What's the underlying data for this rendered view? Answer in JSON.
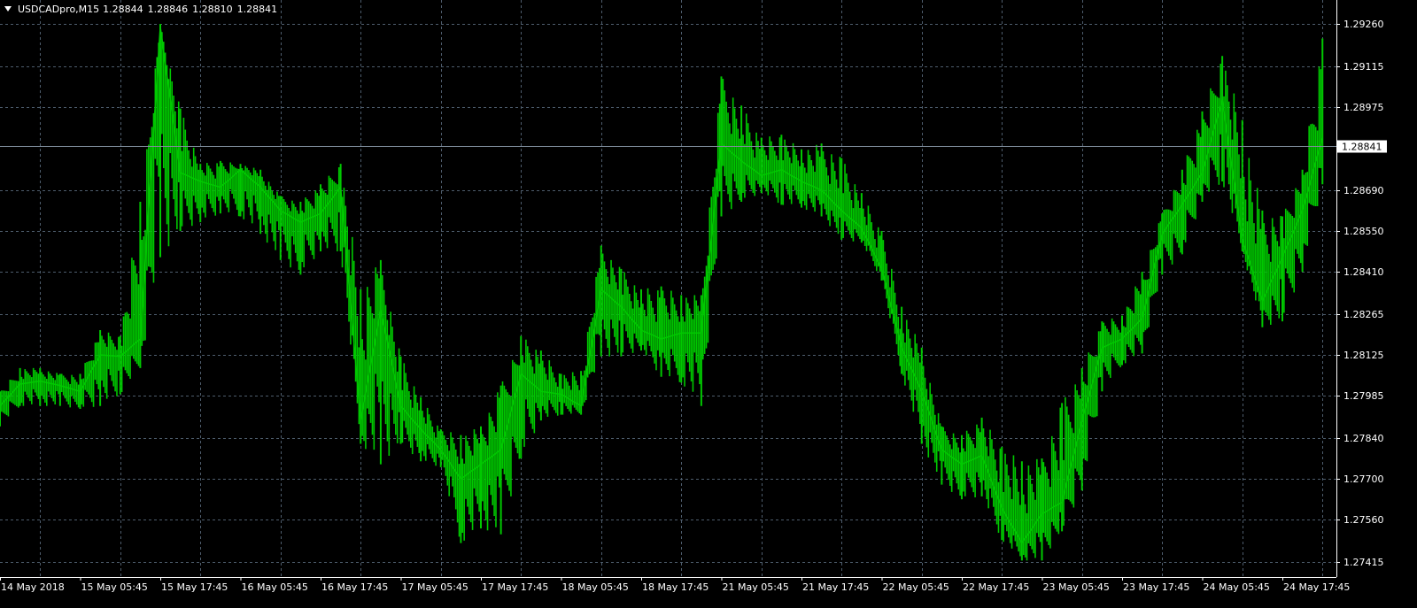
{
  "header": {
    "symbol_timeframe": "USDCADpro,M15",
    "open": "1.28844",
    "high": "1.28846",
    "low": "1.28810",
    "close": "1.28841"
  },
  "colors": {
    "background": "#000000",
    "candles": "#00c800",
    "grid": "#4e5d6d",
    "axis_text": "#ffffff",
    "price_line": "#7d8b99",
    "price_label_bg": "#ffffff",
    "price_label_text": "#000000"
  },
  "chart_data": {
    "type": "line",
    "style": "bar-candlestick",
    "symbol": "USDCADpro",
    "timeframe": "M15",
    "grid": true,
    "ylim": [
      1.2735,
      1.2935
    ],
    "y_ticks": [
      "1.29260",
      "1.29115",
      "1.28975",
      "1.28690",
      "1.28550",
      "1.28410",
      "1.28265",
      "1.28125",
      "1.27985",
      "1.27840",
      "1.27700",
      "1.27560",
      "1.27415"
    ],
    "y_tick_values": [
      1.2926,
      1.29115,
      1.28975,
      1.2869,
      1.2855,
      1.2841,
      1.28265,
      1.28125,
      1.27985,
      1.2784,
      1.277,
      1.2756,
      1.27415
    ],
    "current_price": "1.28841",
    "current_price_value": 1.28841,
    "x_labels": [
      "14 May 2018",
      "15 May 05:45",
      "15 May 17:45",
      "16 May 05:45",
      "16 May 17:45",
      "17 May 05:45",
      "17 May 17:45",
      "18 May 05:45",
      "18 May 17:45",
      "21 May 05:45",
      "21 May 17:45",
      "22 May 05:45",
      "22 May 17:45",
      "23 May 05:45",
      "23 May 17:45",
      "24 May 05:45",
      "24 May 17:45"
    ],
    "series": [
      {
        "x": [
          0,
          0.25,
          0.5,
          0.75,
          1,
          1.25,
          1.5,
          1.75,
          2,
          2.25,
          2.5,
          2.75,
          3,
          3.25,
          3.5,
          3.75,
          4,
          4.25,
          4.5,
          4.75,
          5,
          5.25,
          5.5,
          5.75,
          6,
          6.25,
          6.5,
          6.75,
          7,
          7.25,
          7.5,
          7.75,
          8,
          8.25,
          8.5,
          8.75,
          9,
          9.25,
          9.5,
          9.75,
          10,
          10.25,
          10.5,
          10.75,
          11,
          11.25,
          11.5,
          11.75,
          12,
          12.25,
          12.5,
          12.75,
          13,
          13.25,
          13.5,
          13.75,
          14,
          14.25,
          14.5,
          14.75,
          15,
          15.25,
          15.5,
          15.75,
          16,
          16.25,
          16.5
        ],
        "values": [
          1.2795,
          1.28025,
          1.28035,
          1.2802,
          1.28,
          1.28125,
          1.2812,
          1.2818,
          1.2925,
          1.2875,
          1.2872,
          1.287,
          1.2876,
          1.287,
          1.2862,
          1.2858,
          1.2861,
          1.287,
          1.279,
          1.2828,
          1.2795,
          1.2787,
          1.278,
          1.277,
          1.2775,
          1.278,
          1.2806,
          1.28,
          1.2799,
          1.2795,
          1.2835,
          1.2829,
          1.2821,
          1.2818,
          1.282,
          1.282,
          1.2885,
          1.2879,
          1.2874,
          1.2876,
          1.2872,
          1.2869,
          1.2862,
          1.2856,
          1.2842,
          1.2815,
          1.28,
          1.278,
          1.2775,
          1.2778,
          1.276,
          1.2748,
          1.2758,
          1.2762,
          1.279,
          1.2815,
          1.2818,
          1.2825,
          1.2854,
          1.2864,
          1.2875,
          1.29,
          1.2852,
          1.2831,
          1.2846,
          1.2862,
          1.2887
        ],
        "high": [
          1.28,
          1.2808,
          1.2808,
          1.2806,
          1.2806,
          1.2821,
          1.2819,
          1.2865,
          1.2926,
          1.2897,
          1.2878,
          1.2879,
          1.2878,
          1.2876,
          1.2867,
          1.2865,
          1.2871,
          1.2878,
          1.2835,
          1.2845,
          1.2812,
          1.2798,
          1.2787,
          1.2785,
          1.2788,
          1.2802,
          1.2819,
          1.2814,
          1.2806,
          1.2807,
          1.285,
          1.2842,
          1.2835,
          1.2836,
          1.2833,
          1.2833,
          1.2908,
          1.2898,
          1.2887,
          1.2888,
          1.2883,
          1.2885,
          1.288,
          1.2868,
          1.2855,
          1.2829,
          1.2815,
          1.2788,
          1.2785,
          1.2791,
          1.2781,
          1.2776,
          1.2777,
          1.2796,
          1.2808,
          1.2824,
          1.2826,
          1.2841,
          1.2861,
          1.2876,
          1.2896,
          1.2915,
          1.2893,
          1.2862,
          1.286,
          1.2876,
          1.2921
        ],
        "low": [
          1.2788,
          1.2795,
          1.2795,
          1.2795,
          1.2794,
          1.2795,
          1.2799,
          1.2808,
          1.2846,
          1.2855,
          1.2858,
          1.2861,
          1.286,
          1.2854,
          1.2845,
          1.284,
          1.2848,
          1.2848,
          1.2782,
          1.2775,
          1.2782,
          1.2776,
          1.2774,
          1.2748,
          1.2753,
          1.2751,
          1.2777,
          1.279,
          1.2792,
          1.2792,
          1.2812,
          1.2812,
          1.2814,
          1.2805,
          1.2803,
          1.2795,
          1.286,
          1.2865,
          1.2868,
          1.2864,
          1.2863,
          1.286,
          1.2852,
          1.2851,
          1.2838,
          1.2806,
          1.2782,
          1.2768,
          1.2763,
          1.2764,
          1.2749,
          1.2742,
          1.2742,
          1.2752,
          1.2766,
          1.28,
          1.2809,
          1.2813,
          1.284,
          1.2847,
          1.2865,
          1.2872,
          1.2848,
          1.2822,
          1.2824,
          1.2841,
          1.2871
        ]
      }
    ]
  }
}
